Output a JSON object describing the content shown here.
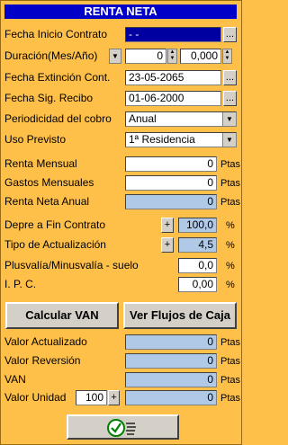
{
  "title": "RENTA NETA",
  "labels": {
    "fecha_inicio": "Fecha Inicio Contrato",
    "duracion": "Duración(Mes/Año)",
    "fecha_extincion": "Fecha Extinción Cont.",
    "fecha_sig_recibo": "Fecha Sig. Recibo",
    "periodicidad": "Periodicidad del cobro",
    "uso": "Uso Previsto",
    "renta_mensual": "Renta Mensual",
    "gastos_mensuales": "Gastos Mensuales",
    "renta_neta_anual": "Renta Neta Anual",
    "depre": "Depre a Fin Contrato",
    "tipo_act": "Tipo de Actualización",
    "plusvalia": "Plusvalía/Minusvalía - suelo",
    "ipc": "I. P. C.",
    "valor_actualizado": "Valor Actualizado",
    "valor_reversion": "Valor Reversión",
    "van": "VAN",
    "valor_unidad": "Valor Unidad"
  },
  "values": {
    "fecha_inicio": "- -",
    "duracion_mes": "0",
    "duracion_anio": "0,000",
    "fecha_extincion": "23-05-2065",
    "fecha_sig_recibo": "01-06-2000",
    "periodicidad": "Anual",
    "uso": "1ª Residencia",
    "renta_mensual": "0",
    "gastos_mensuales": "0",
    "renta_neta_anual": "0",
    "depre": "100,0",
    "tipo_act": "4,5",
    "plusvalia": "0,0",
    "ipc": "0,00",
    "valor_actualizado": "0",
    "valor_reversion": "0",
    "van": "0",
    "valor_unidad_qty": "100",
    "valor_unidad": "0"
  },
  "units": {
    "ptas": "Ptas",
    "pct": "%"
  },
  "buttons": {
    "ellipsis": "...",
    "plus": "+",
    "calcular": "Calcular VAN",
    "flujos": "Ver Flujos de Caja"
  },
  "colors": {
    "background": "#FFC04A",
    "title_bar": "#0000C8",
    "computed_field": "#AFC9E6"
  }
}
